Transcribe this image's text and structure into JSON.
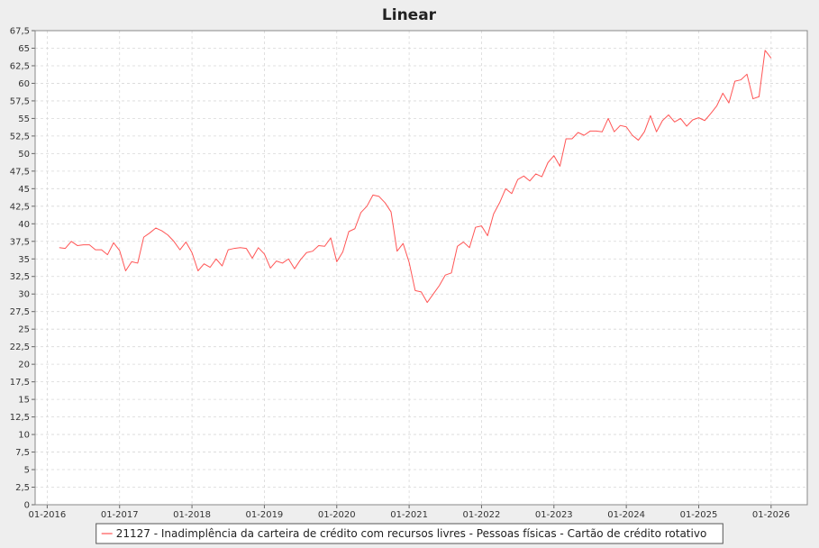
{
  "chart_data": {
    "type": "line",
    "title": "Linear",
    "xlabel": "",
    "ylabel": "",
    "ylim": [
      0,
      67.5
    ],
    "y_ticks": [
      0,
      2.5,
      5,
      7.5,
      10,
      12.5,
      15,
      17.5,
      20,
      22.5,
      25,
      27.5,
      30,
      32.5,
      35,
      37.5,
      40,
      42.5,
      45,
      47.5,
      50,
      52.5,
      55,
      57.5,
      60,
      62.5,
      65,
      67.5
    ],
    "y_tick_labels": [
      "0",
      "2,5",
      "5",
      "7,5",
      "10",
      "12,5",
      "15",
      "17,5",
      "20",
      "22,5",
      "25",
      "27,5",
      "30",
      "32,5",
      "35",
      "37,5",
      "40",
      "42,5",
      "45",
      "47,5",
      "50",
      "52,5",
      "55",
      "57,5",
      "60",
      "62,5",
      "65",
      "67,5"
    ],
    "xlim": [
      "2015-11",
      "2026-07"
    ],
    "x_ticks": [
      "2016-01",
      "2017-01",
      "2018-01",
      "2019-01",
      "2020-01",
      "2021-01",
      "2022-01",
      "2023-01",
      "2024-01",
      "2025-01",
      "2026-01"
    ],
    "x_tick_labels": [
      "01-2016",
      "01-2017",
      "01-2018",
      "01-2019",
      "01-2020",
      "01-2021",
      "01-2022",
      "01-2023",
      "01-2024",
      "01-2025",
      "01-2026"
    ],
    "grid": true,
    "legend_position": "bottom",
    "colors": {
      "series": "#ff5555",
      "grid": "#d8d8d8",
      "plot_bg": "#ffffff",
      "frame": "#888888",
      "page_bg": "#eeeeee"
    },
    "series": [
      {
        "name": "21127 - Inadimplência da carteira de crédito com recursos livres - Pessoas físicas - Cartão de crédito rotativo",
        "x": [
          "2016-03",
          "2016-04",
          "2016-05",
          "2016-06",
          "2016-07",
          "2016-08",
          "2016-09",
          "2016-10",
          "2016-11",
          "2016-12",
          "2017-01",
          "2017-02",
          "2017-03",
          "2017-04",
          "2017-05",
          "2017-06",
          "2017-07",
          "2017-08",
          "2017-09",
          "2017-10",
          "2017-11",
          "2017-12",
          "2018-01",
          "2018-02",
          "2018-03",
          "2018-04",
          "2018-05",
          "2018-06",
          "2018-07",
          "2018-08",
          "2018-09",
          "2018-10",
          "2018-11",
          "2018-12",
          "2019-01",
          "2019-02",
          "2019-03",
          "2019-04",
          "2019-05",
          "2019-06",
          "2019-07",
          "2019-08",
          "2019-09",
          "2019-10",
          "2019-11",
          "2019-12",
          "2020-01",
          "2020-02",
          "2020-03",
          "2020-04",
          "2020-05",
          "2020-06",
          "2020-07",
          "2020-08",
          "2020-09",
          "2020-10",
          "2020-11",
          "2020-12",
          "2021-01",
          "2021-02",
          "2021-03",
          "2021-04",
          "2021-05",
          "2021-06",
          "2021-07",
          "2021-08",
          "2021-09",
          "2021-10",
          "2021-11",
          "2021-12",
          "2022-01",
          "2022-02",
          "2022-03",
          "2022-04",
          "2022-05",
          "2022-06",
          "2022-07",
          "2022-08",
          "2022-09",
          "2022-10",
          "2022-11",
          "2022-12",
          "2023-01",
          "2023-02",
          "2023-03",
          "2023-04",
          "2023-05",
          "2023-06",
          "2023-07",
          "2023-08",
          "2023-09",
          "2023-10",
          "2023-11",
          "2023-12",
          "2024-01",
          "2024-02",
          "2024-03",
          "2024-04",
          "2024-05",
          "2024-06",
          "2024-07",
          "2024-08",
          "2024-09",
          "2024-10",
          "2024-11",
          "2024-12",
          "2025-01",
          "2025-02",
          "2025-03",
          "2025-04",
          "2025-05",
          "2025-06",
          "2025-07",
          "2025-08",
          "2025-09",
          "2025-10",
          "2025-11",
          "2025-12",
          "2026-01"
        ],
        "values": [
          36.6,
          36.5,
          37.5,
          36.9,
          37.0,
          37.0,
          36.3,
          36.3,
          35.6,
          37.3,
          36.2,
          33.3,
          34.6,
          34.4,
          38.1,
          38.7,
          39.4,
          39.0,
          38.4,
          37.5,
          36.3,
          37.4,
          35.9,
          33.3,
          34.3,
          33.8,
          35.0,
          34.0,
          36.3,
          36.5,
          36.6,
          36.5,
          35.1,
          36.6,
          35.7,
          33.7,
          34.7,
          34.4,
          35.0,
          33.6,
          34.9,
          35.9,
          36.1,
          36.9,
          36.8,
          38.0,
          34.6,
          36.0,
          38.9,
          39.3,
          41.6,
          42.5,
          44.1,
          43.9,
          43.0,
          41.7,
          36.1,
          37.2,
          34.5,
          30.5,
          30.3,
          28.8,
          30.0,
          31.2,
          32.7,
          33.0,
          36.8,
          37.4,
          36.6,
          39.5,
          39.7,
          38.3,
          41.4,
          43.0,
          45.0,
          44.3,
          46.3,
          46.8,
          46.1,
          47.1,
          46.7,
          48.7,
          49.7,
          48.2,
          52.1,
          52.1,
          53.0,
          52.6,
          53.2,
          53.2,
          53.1,
          55.0,
          53.1,
          54.0,
          53.8,
          52.6,
          51.9,
          53.1,
          55.4,
          53.1,
          54.7,
          55.5,
          54.5,
          55.0,
          53.9,
          54.8,
          55.1,
          54.7,
          55.7,
          56.8,
          58.6,
          57.2,
          60.3,
          60.5,
          61.3,
          57.8,
          58.1,
          64.7,
          63.6
        ]
      }
    ]
  }
}
